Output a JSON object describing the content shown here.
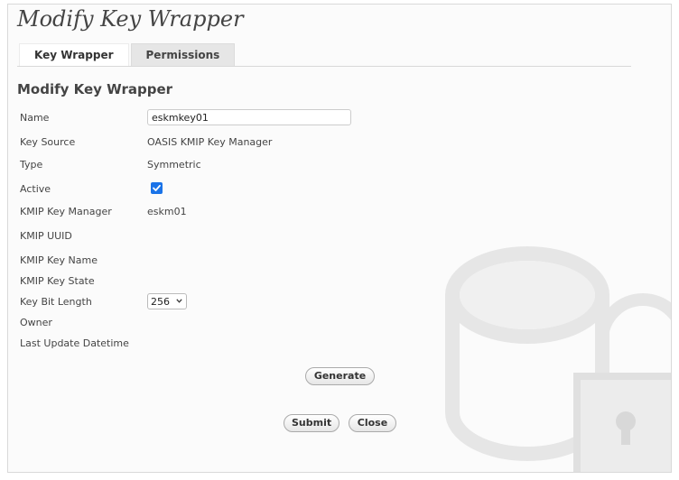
{
  "page": {
    "title": "Modify Key Wrapper"
  },
  "tabs": [
    {
      "label": "Key Wrapper"
    },
    {
      "label": "Permissions"
    }
  ],
  "form": {
    "section_title": "Modify Key Wrapper",
    "name": {
      "label": "Name",
      "value": "eskmkey01"
    },
    "key_source": {
      "label": "Key Source",
      "value": "OASIS KMIP Key Manager"
    },
    "type": {
      "label": "Type",
      "value": "Symmetric"
    },
    "active": {
      "label": "Active",
      "checked": true
    },
    "kmip_key_manager": {
      "label": "KMIP Key Manager",
      "value": "eskm01"
    },
    "kmip_uuid": {
      "label": "KMIP UUID",
      "value": ""
    },
    "kmip_key_name": {
      "label": "KMIP Key Name",
      "value": ""
    },
    "kmip_key_state": {
      "label": "KMIP Key State",
      "value": ""
    },
    "key_bit_length": {
      "label": "Key Bit Length",
      "selected": "256"
    },
    "owner": {
      "label": "Owner",
      "value": ""
    },
    "last_update": {
      "label": "Last Update Datetime",
      "value": ""
    }
  },
  "buttons": {
    "generate": "Generate",
    "submit": "Submit",
    "close": "Close"
  },
  "colors": {
    "checkbox_accent": "#1a73e8",
    "watermark": "#e6e6e6"
  },
  "icons": {
    "watermark": "database-lock-icon",
    "checkbox": "checkmark-icon",
    "select": "chevron-down-icon"
  }
}
